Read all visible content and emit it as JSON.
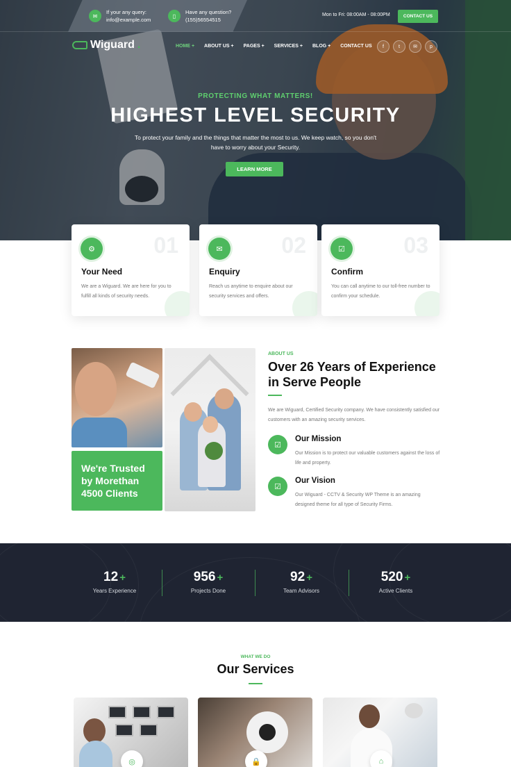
{
  "topbar": {
    "query_label": "If your any query:",
    "query_value": "info@example.com",
    "question_label": "Have any question?",
    "question_value": "(155)56554515",
    "hours": "Mon to Fri: 08:00AM - 08:00PM",
    "contact_btn": "CONTACT US",
    "mail_icon": "mail-icon",
    "phone_icon": "phone-icon"
  },
  "nav": {
    "logo_text": "Wiguard",
    "logo_dot": ".",
    "items": [
      {
        "label": "HOME +"
      },
      {
        "label": "ABOUT US +"
      },
      {
        "label": "PAGES +"
      },
      {
        "label": "SERVICES +"
      },
      {
        "label": "BLOG +"
      },
      {
        "label": "CONTACT US"
      }
    ],
    "socials": [
      "f",
      "t",
      "✉",
      "p"
    ],
    "active_color": "#6fd37e"
  },
  "hero": {
    "tag": "PROTECTING WHAT MATTERS!",
    "title": "HIGHEST LEVEL SECURITY",
    "text": "To protect your family and the things that matter the most to us. We keep watch, so you don't have to worry about your Security.",
    "button": "LEARN MORE"
  },
  "steps": [
    {
      "num": "01",
      "title": "Your Need",
      "text": "We are a Wiguard. We are here for you to fulfill all kinds of security needs.",
      "icon": "gear-icon",
      "glyph": "⚙"
    },
    {
      "num": "02",
      "title": "Enquiry",
      "text": "Reach us anytime to enquire about our security services and offers.",
      "icon": "mail-icon",
      "glyph": "✉"
    },
    {
      "num": "03",
      "title": "Confirm",
      "text": "You can call anytime to our toll-free number to confirm your schedule.",
      "icon": "checkbox-icon",
      "glyph": "☑"
    }
  ],
  "about": {
    "trusted": "We're Trusted by Morethan 4500 Clients",
    "tag": "ABOUT US",
    "title": "Over 26 Years of Experience in Serve People",
    "text": "We are Wiguard, Certified Security company. We have consistently satisfied our customers with an amazing security services.",
    "features": [
      {
        "title": "Our Mission",
        "text": "Our Mission is to protect our valuable customers against the loss of life and property.",
        "glyph": "☑"
      },
      {
        "title": "Our Vision",
        "text": "Our Wiguard - CCTV & Security WP Theme is an amazing designed theme for all type of Security Firms.",
        "glyph": "☑"
      }
    ]
  },
  "stats": [
    {
      "value": "12",
      "plus": "+",
      "label": "Years Experience"
    },
    {
      "value": "956",
      "plus": "+",
      "label": "Projects Done"
    },
    {
      "value": "92",
      "plus": "+",
      "label": "Team Advisors"
    },
    {
      "value": "520",
      "plus": "+",
      "label": "Active Clients"
    }
  ],
  "services": {
    "tag": "WHAT WE DO",
    "title": "Our Services",
    "cards": [
      {
        "icon": "fingerprint-icon",
        "glyph": "◎"
      },
      {
        "icon": "lock-icon",
        "glyph": "🔒"
      },
      {
        "icon": "camera-icon",
        "glyph": "⌂"
      }
    ]
  },
  "colors": {
    "accent": "#4cb85c",
    "dark": "#1f2432"
  }
}
